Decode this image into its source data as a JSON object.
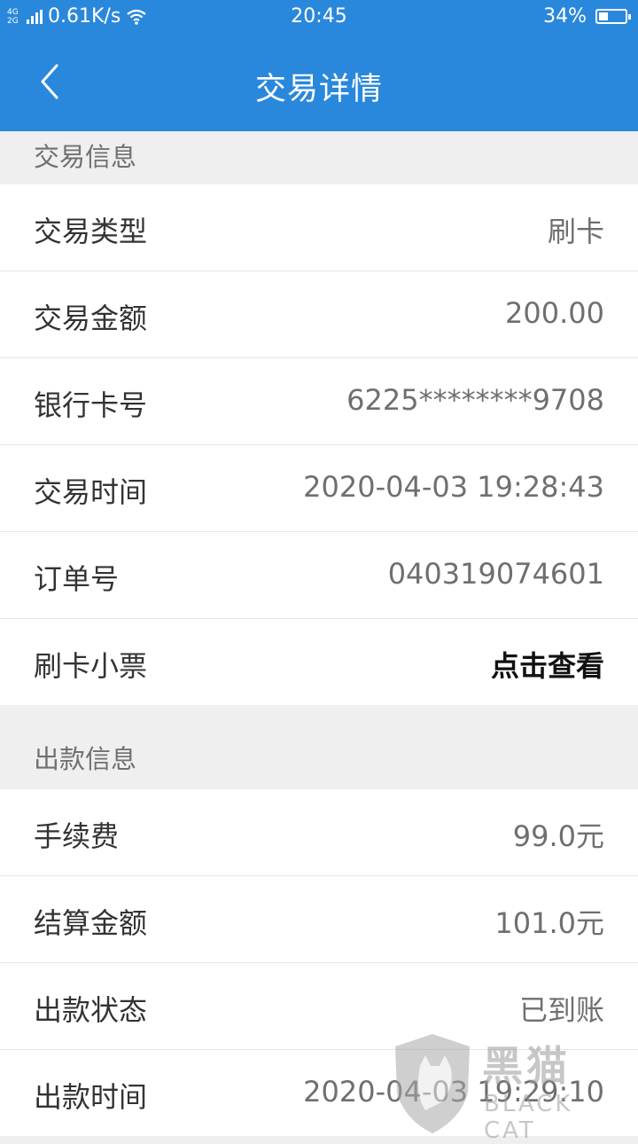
{
  "status_bar": {
    "network": "4G 2G",
    "speed": "0.61K/s",
    "time": "20:45",
    "battery_percent": "34%",
    "battery_level": 0.34
  },
  "header": {
    "title": "交易详情"
  },
  "sections": {
    "trade": {
      "title": "交易信息",
      "rows": [
        {
          "label": "交易类型",
          "value": "刷卡"
        },
        {
          "label": "交易金额",
          "value": "200.00"
        },
        {
          "label": "银行卡号",
          "value": "6225********9708"
        },
        {
          "label": "交易时间",
          "value": "2020-04-03 19:28:43"
        },
        {
          "label": "订单号",
          "value": "040319074601"
        },
        {
          "label": "刷卡小票",
          "value": "点击查看"
        }
      ]
    },
    "payout": {
      "title": "出款信息",
      "rows": [
        {
          "label": "手续费",
          "value": "99.0元"
        },
        {
          "label": "结算金额",
          "value": "101.0元"
        },
        {
          "label": "出款状态",
          "value": "已到账"
        },
        {
          "label": "出款时间",
          "value": "2020-04-03 19:29:10"
        }
      ]
    }
  },
  "watermark": {
    "logo_text": "黑猫",
    "brand": "BLACK CAT"
  },
  "colors": {
    "primary": "#2a88dc",
    "background": "#efefef"
  }
}
